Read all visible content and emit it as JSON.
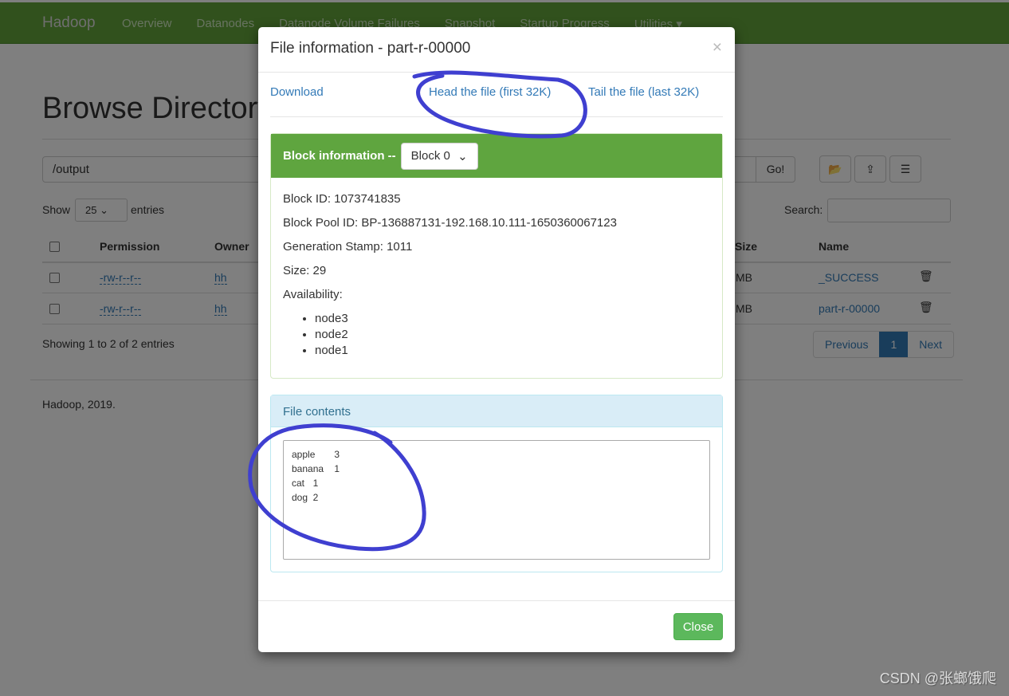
{
  "navbar": {
    "brand": "Hadoop",
    "items": [
      "Overview",
      "Datanodes",
      "Datanode Volume Failures",
      "Snapshot",
      "Startup Progress",
      "Utilities ▾"
    ],
    "color": "#63a33b"
  },
  "page": {
    "title": "Browse Directory",
    "path": "/output",
    "go": "Go!",
    "show": "Show",
    "page_size": "25",
    "entries": "entries",
    "search_label": "Search:",
    "columns": [
      "Permission",
      "Owner",
      "Block Size",
      "Name"
    ],
    "rows": [
      {
        "permission": "-rw-r--r--",
        "owner": "hh",
        "block_size": "MB",
        "name": "_SUCCESS"
      },
      {
        "permission": "-rw-r--r--",
        "owner": "hh",
        "block_size": "MB",
        "name": "part-r-00000"
      }
    ],
    "showing": "Showing 1 to 2 of 2 entries",
    "previous": "Previous",
    "current_page": "1",
    "next": "Next",
    "footer": "Hadoop, 2019."
  },
  "modal": {
    "title": "File information - part-r-00000",
    "close_x": "×",
    "download": "Download",
    "head": "Head the file (first 32K)",
    "tail": "Tail the file (last 32K)",
    "block_label": "Block information --",
    "block_selected": "Block 0",
    "block_id": "Block ID: 1073741835",
    "block_pool": "Block Pool ID: BP-136887131-192.168.10.111-1650360067123",
    "gen_stamp": "Generation Stamp: 1011",
    "size": "Size: 29",
    "availability": "Availability:",
    "nodes": [
      "node3",
      "node2",
      "node1"
    ],
    "contents_label": "File contents",
    "contents": "apple\t3\nbanana\t1\ncat\t1\ndog\t2",
    "close": "Close"
  },
  "watermark": "CSDN @张螂饿爬",
  "annotation_color": "#3f3fd0"
}
